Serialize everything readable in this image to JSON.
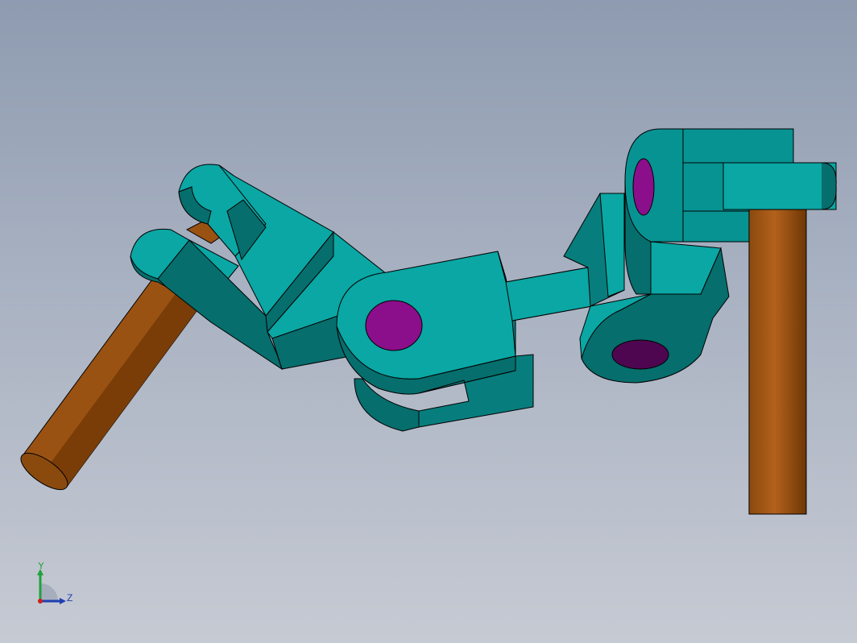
{
  "viewport": {
    "background_top": "#8e9bb0",
    "background_bottom": "#c6cad3"
  },
  "model": {
    "colors": {
      "link_light": "#0aa7a4",
      "link_mid": "#089393",
      "link_dark": "#066e6d",
      "link_darker": "#055a59",
      "pin": "#8b0f8a",
      "pin_dark": "#4f0650",
      "rod_light": "#b3611c",
      "rod_mid": "#97500f",
      "rod_dark": "#6e3706"
    }
  },
  "triad": {
    "y_label": "Y",
    "z_label": "Z",
    "y_color": "#1fa23a",
    "z_color": "#1f3fb0",
    "origin_color": "#cc1f1f"
  }
}
